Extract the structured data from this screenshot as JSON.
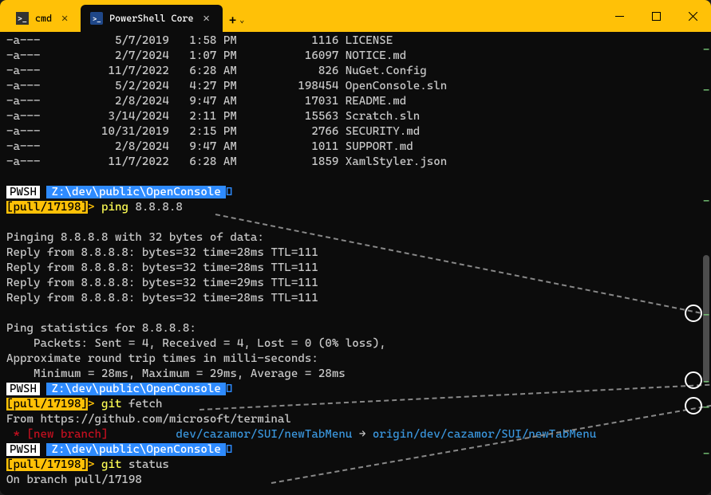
{
  "tabs": [
    {
      "icon": "cmd",
      "label": "cmd",
      "active": false
    },
    {
      "icon": "pwsh",
      "label": "PowerShell Core",
      "active": true
    }
  ],
  "files": [
    {
      "mode": "-a---",
      "date": "5/7/2019",
      "time": "1:58 PM",
      "size": "1116",
      "name": "LICENSE"
    },
    {
      "mode": "-a---",
      "date": "2/7/2024",
      "time": "1:07 PM",
      "size": "16097",
      "name": "NOTICE.md"
    },
    {
      "mode": "-a---",
      "date": "11/7/2022",
      "time": "6:28 AM",
      "size": "826",
      "name": "NuGet.Config"
    },
    {
      "mode": "-a---",
      "date": "5/2/2024",
      "time": "4:27 PM",
      "size": "198454",
      "name": "OpenConsole.sln"
    },
    {
      "mode": "-a---",
      "date": "2/8/2024",
      "time": "9:47 AM",
      "size": "17031",
      "name": "README.md"
    },
    {
      "mode": "-a---",
      "date": "3/14/2024",
      "time": "2:11 PM",
      "size": "15563",
      "name": "Scratch.sln"
    },
    {
      "mode": "-a---",
      "date": "10/31/2019",
      "time": "2:15 PM",
      "size": "2766",
      "name": "SECURITY.md"
    },
    {
      "mode": "-a---",
      "date": "2/8/2024",
      "time": "9:47 AM",
      "size": "1011",
      "name": "SUPPORT.md"
    },
    {
      "mode": "-a---",
      "date": "11/7/2022",
      "time": "6:28 AM",
      "size": "1859",
      "name": "XamlStyler.json"
    }
  ],
  "prompt": {
    "shell": "PWSH",
    "path": "Z:\\dev\\public\\OpenConsole",
    "branch": "[pull/17198]",
    "sep": ">"
  },
  "cmds": {
    "ping": {
      "exe": "ping",
      "arg": "8.8.8.8"
    },
    "fetch": {
      "exe": "git",
      "arg": "fetch"
    },
    "status": {
      "exe": "git",
      "arg": "status"
    }
  },
  "ping": {
    "header": "Pinging 8.8.8.8 with 32 bytes of data:",
    "replies": [
      "Reply from 8.8.8.8: bytes=32 time=28ms TTL=111",
      "Reply from 8.8.8.8: bytes=32 time=28ms TTL=111",
      "Reply from 8.8.8.8: bytes=32 time=29ms TTL=111",
      "Reply from 8.8.8.8: bytes=32 time=28ms TTL=111"
    ],
    "stats1": "Ping statistics for 8.8.8.8:",
    "stats2": "    Packets: Sent = 4, Received = 4, Lost = 0 (0% loss),",
    "stats3": "Approximate round trip times in milli-seconds:",
    "stats4": "    Minimum = 28ms, Maximum = 29ms, Average = 28ms"
  },
  "fetch": {
    "from": "From https://github.com/microsoft/terminal",
    "branch_pre": " * [new branch]          ",
    "branch_mid": "dev/cazamor/SUI/newTabMenu",
    "branch_arr": " → ",
    "branch_post": "origin/dev/cazamor/SUI/newTabMenu"
  },
  "status": {
    "line": "On branch pull/17198"
  }
}
